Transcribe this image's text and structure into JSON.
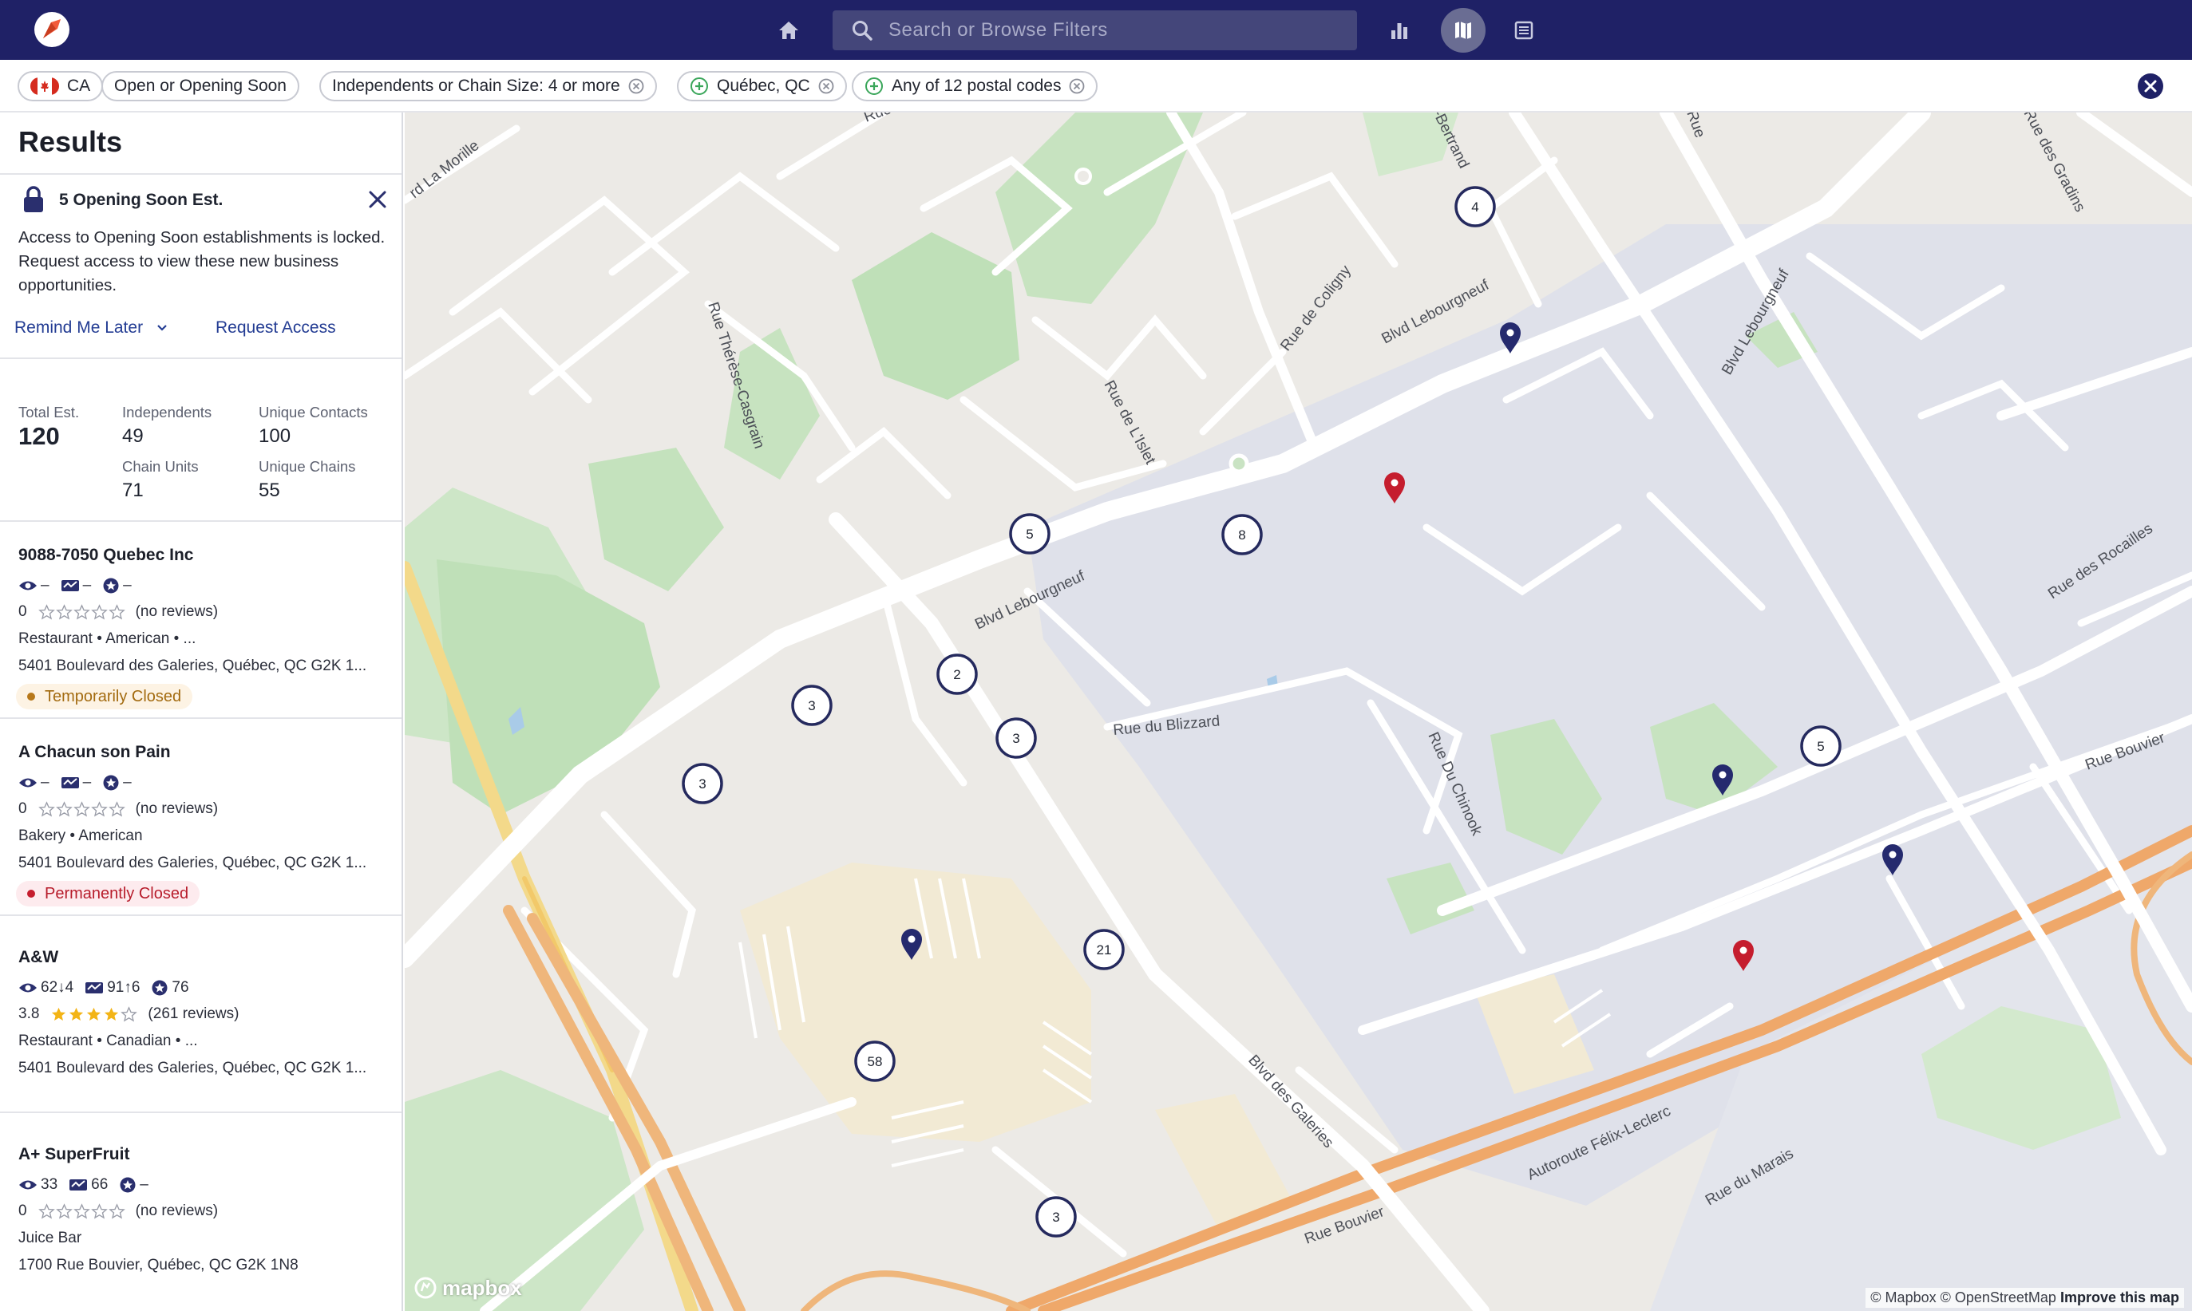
{
  "header": {
    "search_placeholder": "Search or Browse Filters",
    "brand_color": "#1f2166"
  },
  "filters": {
    "country": "CA",
    "chips": [
      {
        "label": "Open or Opening Soon"
      },
      {
        "label": "Independents or Chain Size: 4 or more"
      },
      {
        "label": "Québec, QC"
      },
      {
        "label": "Any of 12 postal codes"
      }
    ]
  },
  "results": {
    "title": "Results",
    "notice": {
      "title": "5 Opening Soon Est.",
      "text": "Access to Opening Soon establishments is locked. Request access to view these new business opportunities.",
      "remind_label": "Remind Me Later",
      "request_label": "Request Access"
    },
    "stats": {
      "total_label": "Total Est.",
      "total_value": "120",
      "independents_label": "Independents",
      "independents_value": "49",
      "chain_units_label": "Chain Units",
      "chain_units_value": "71",
      "unique_contacts_label": "Unique Contacts",
      "unique_contacts_value": "100",
      "unique_chains_label": "Unique Chains",
      "unique_chains_value": "55"
    },
    "listings": [
      {
        "name": "9088-7050 Quebec Inc",
        "views": "–",
        "visits": "–",
        "score": "–",
        "rating": "0",
        "stars_filled": 0,
        "reviews": "(no reviews)",
        "category": "Restaurant • American • ...",
        "address": "5401 Boulevard des Galeries, Québec, QC G2K 1...",
        "status": "Temporarily Closed"
      },
      {
        "name": "A Chacun son Pain",
        "views": "–",
        "visits": "–",
        "score": "–",
        "rating": "0",
        "stars_filled": 0,
        "reviews": "(no reviews)",
        "category": "Bakery • American",
        "address": "5401 Boulevard des Galeries, Québec, QC G2K 1...",
        "status": "Permanently Closed"
      },
      {
        "name": "A&W",
        "views": "62↓4",
        "visits": "91↑6",
        "score": "76",
        "rating": "3.8",
        "stars_filled": 4,
        "reviews": "(261 reviews)",
        "category": "Restaurant • Canadian • ...",
        "address": "5401 Boulevard des Galeries, Québec, QC G2K 1..."
      },
      {
        "name": "A+ SuperFruit",
        "views": "33",
        "visits": "66",
        "score": "–",
        "rating": "0",
        "stars_filled": 0,
        "reviews": "(no reviews)",
        "category": "Juice Bar",
        "address": "1700 Rue Bouvier, Québec, QC G2K 1N8"
      }
    ]
  },
  "map": {
    "clusters": [
      "4",
      "5",
      "8",
      "2",
      "3",
      "3",
      "3",
      "5",
      "21",
      "58",
      "3"
    ],
    "streets": [
      "Blvd Lebourgneuf",
      "Blvd Lebourgneuf",
      "Blvd Lebourgneuf",
      "Rue Thérèse-Casgrain",
      "Rue de Coligny",
      "Rue de L'Islet",
      "Rue du Blizzard",
      "Rue Du Chinook",
      "Blvd des Galeries",
      "Autoroute Félix-Leclerc",
      "Rue Bouvier",
      "Rue Bouvier",
      "Rue du Marais",
      "Rue des Rocailles",
      "Rue des Gradins",
      "-Bertrand",
      "rd La Morille",
      "Rue",
      "Rue"
    ],
    "logo": "mapbox",
    "attribution_prefix": "© Mapbox © OpenStreetMap",
    "attribution_link": "Improve this map"
  }
}
